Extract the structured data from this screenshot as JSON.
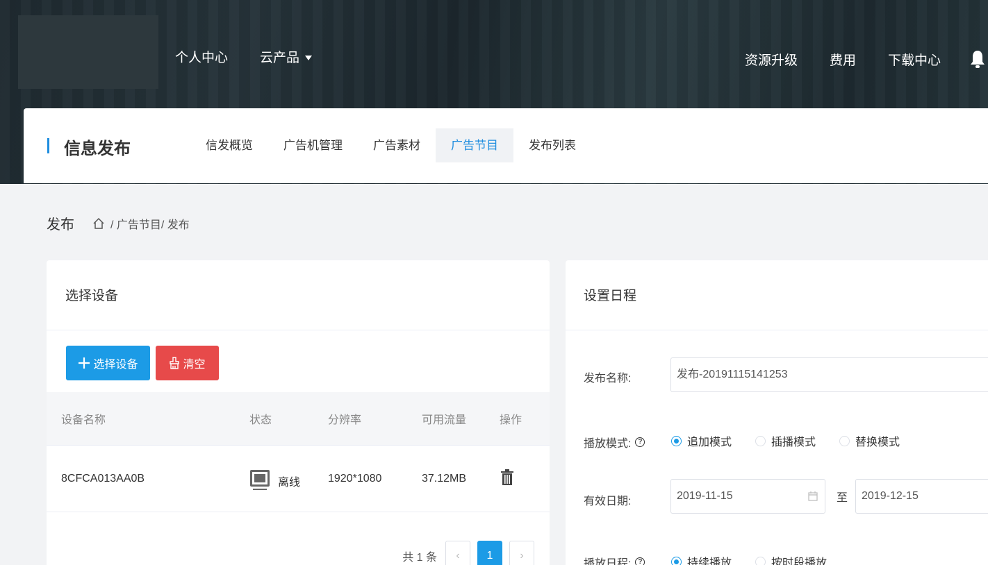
{
  "header": {
    "nav_left": [
      "个人中心",
      "云产品"
    ],
    "nav_right": [
      "资源升级",
      "费用",
      "下载中心"
    ]
  },
  "subheader": {
    "title": "信息发布",
    "tabs": [
      "信发概览",
      "广告机管理",
      "广告素材",
      "广告节目",
      "发布列表"
    ],
    "active_tab": "广告节目"
  },
  "breadcrumb": {
    "title": "发布",
    "path": "/ 广告节目/ 发布"
  },
  "device_panel": {
    "title": "选择设备",
    "select_button": "选择设备",
    "clear_button": "清空",
    "columns": [
      "设备名称",
      "状态",
      "分辨率",
      "可用流量",
      "操作"
    ],
    "rows": [
      {
        "name": "8CFCA013AA0B",
        "status": "离线",
        "resolution": "1920*1080",
        "traffic": "37.12MB"
      }
    ],
    "pagination": {
      "total": "共 1 条",
      "current": "1",
      "prev": "‹",
      "next": "›"
    }
  },
  "schedule_panel": {
    "title": "设置日程",
    "name_label": "发布名称:",
    "name_value": "发布-20191115141253",
    "mode_label": "播放模式:",
    "modes": [
      "追加模式",
      "插播模式",
      "替换模式"
    ],
    "date_label": "有效日期:",
    "start_date": "2019-11-15",
    "date_separator": "至",
    "end_date": "2019-12-15",
    "schedule_label": "播放日程:",
    "schedules": [
      "持续播放",
      "按时段播放"
    ]
  },
  "colors": {
    "primary": "#1c9be6",
    "danger": "#e74a4a",
    "accent": "#1e8ddf"
  }
}
